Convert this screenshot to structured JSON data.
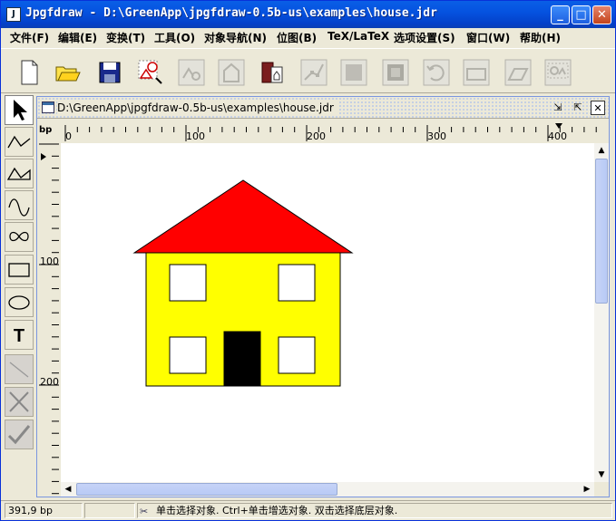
{
  "window": {
    "title": "Jpgfdraw - D:\\GreenApp\\jpgfdraw-0.5b-us\\examples\\house.jdr",
    "app_icon": "jpgfdraw-app-icon",
    "controls": [
      "minimize",
      "maximize",
      "close"
    ]
  },
  "menu": [
    {
      "id": "file",
      "label": "文件(F)"
    },
    {
      "id": "edit",
      "label": "编辑(E)"
    },
    {
      "id": "transform",
      "label": "变换(T)"
    },
    {
      "id": "tools",
      "label": "工具(O)"
    },
    {
      "id": "navigate",
      "label": "对象导航(N)"
    },
    {
      "id": "bitmap",
      "label": "位图(B)"
    },
    {
      "id": "tex",
      "label": "TeX/LaTeX"
    },
    {
      "id": "settings",
      "label": "选项设置(S)"
    },
    {
      "id": "window",
      "label": "窗口(W)"
    },
    {
      "id": "help",
      "label": "帮助(H)"
    }
  ],
  "toolbar": [
    {
      "id": "new",
      "icon": "new-document-icon",
      "enabled": true
    },
    {
      "id": "open",
      "icon": "open-folder-icon",
      "enabled": true
    },
    {
      "id": "save",
      "icon": "save-disk-icon",
      "enabled": true
    },
    {
      "id": "image",
      "icon": "image-export-icon",
      "enabled": true
    },
    {
      "id": "group",
      "icon": "group-icon",
      "enabled": false
    },
    {
      "id": "ungroup",
      "icon": "ungroup-icon",
      "enabled": false
    },
    {
      "id": "delete",
      "icon": "cut-icon",
      "enabled": true
    },
    {
      "id": "edit-path",
      "icon": "edit-path-icon",
      "enabled": false
    },
    {
      "id": "back",
      "icon": "move-back-icon",
      "enabled": false
    },
    {
      "id": "front",
      "icon": "move-front-icon",
      "enabled": false
    },
    {
      "id": "rotate",
      "icon": "rotate-icon",
      "enabled": false
    },
    {
      "id": "scale",
      "icon": "scale-icon",
      "enabled": false
    },
    {
      "id": "shear",
      "icon": "shear-icon",
      "enabled": false
    },
    {
      "id": "reduce",
      "icon": "reduce-to-bitmap-icon",
      "enabled": false
    }
  ],
  "palette": [
    {
      "id": "select",
      "icon": "select-arrow-icon",
      "selected": true,
      "enabled": true
    },
    {
      "id": "open-line",
      "icon": "open-line-icon",
      "selected": false,
      "enabled": true
    },
    {
      "id": "closed-line",
      "icon": "closed-line-icon",
      "selected": false,
      "enabled": true
    },
    {
      "id": "open-curve",
      "icon": "open-curve-icon",
      "selected": false,
      "enabled": true
    },
    {
      "id": "closed-curve",
      "icon": "closed-curve-icon",
      "selected": false,
      "enabled": true
    },
    {
      "id": "rectangle",
      "icon": "rectangle-icon",
      "selected": false,
      "enabled": true
    },
    {
      "id": "ellipse",
      "icon": "ellipse-icon",
      "selected": false,
      "enabled": true
    },
    {
      "id": "text",
      "icon": "text-icon",
      "label": "T",
      "selected": false,
      "enabled": true
    },
    {
      "id": "gap",
      "icon": "gap-icon",
      "selected": false,
      "enabled": false
    },
    {
      "id": "abandon",
      "icon": "abandon-x-icon",
      "selected": false,
      "enabled": false
    },
    {
      "id": "finish",
      "icon": "finish-check-icon",
      "selected": false,
      "enabled": false
    }
  ],
  "document": {
    "title": "D:\\GreenApp\\jpgfdraw-0.5b-us\\examples\\house.jdr",
    "unit": "bp",
    "hruler_labels": [
      "0",
      "100",
      "200",
      "300",
      "400"
    ],
    "vruler_labels": [
      "100",
      "200"
    ]
  },
  "drawing": {
    "roof_color": "#FF0000",
    "wall_color": "#FFFF00",
    "window_color": "#FFFFFF",
    "door_color": "#000000",
    "outline_color": "#000000"
  },
  "status": {
    "coords": "391,9 bp",
    "hint": "单击选择对象. Ctrl+单击增选对象. 双击选择底层对象."
  }
}
